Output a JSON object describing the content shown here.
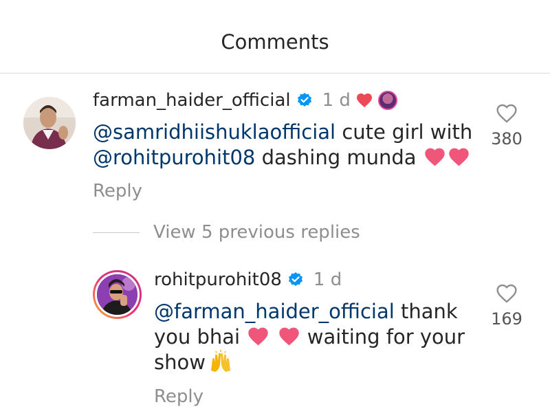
{
  "header": {
    "title": "Comments"
  },
  "comments": [
    {
      "username": "farman_haider_official",
      "time": "1 d",
      "mention1": "@samridhiishuklaofficial",
      "text1": " cute girl with ",
      "mention2": "@rohitpurohit08",
      "text2": " dashing munda",
      "reply_label": "Reply",
      "likes": "380"
    },
    {
      "username": "rohitpurohit08",
      "time": "1 d",
      "mention1": "@farman_haider_official",
      "text1": " thank you bhai ",
      "text2": " waiting for your show",
      "reply_label": "Reply",
      "likes": "169"
    }
  ],
  "view_replies": {
    "label": "View 5 previous replies"
  },
  "colors": {
    "verified": "#0095f6",
    "heart": "#ed4956",
    "mention": "#00376b",
    "secondary": "#8e8e8e"
  },
  "icons": [
    "verified-badge-icon",
    "heart-icon",
    "like-heart-outline-icon",
    "raising-hands-emoji"
  ]
}
